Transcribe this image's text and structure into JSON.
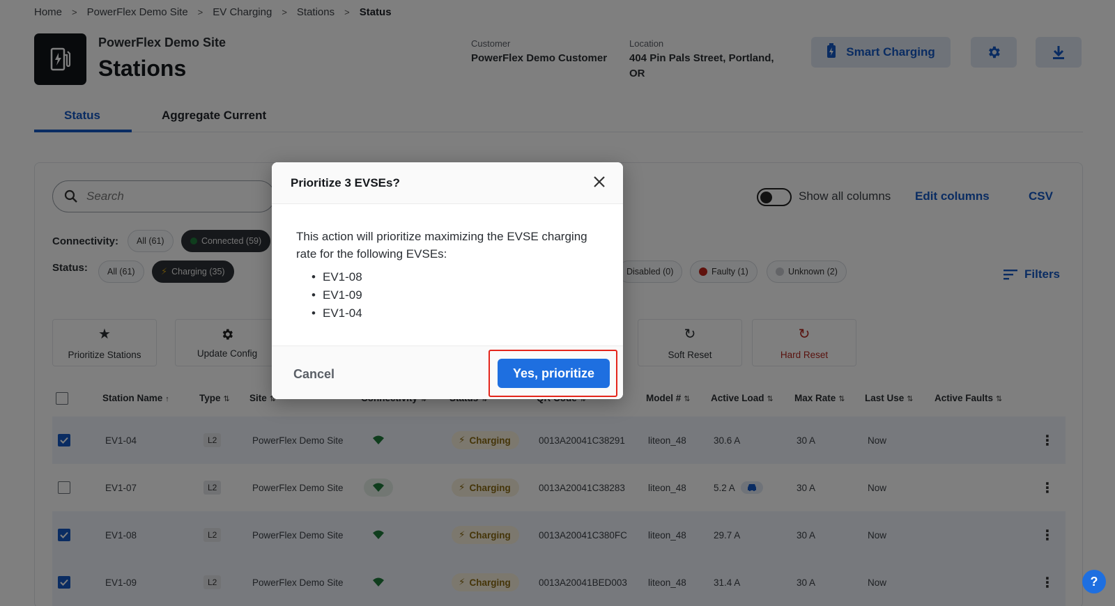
{
  "breadcrumb": [
    "Home",
    "PowerFlex Demo Site",
    "EV Charging",
    "Stations",
    "Status"
  ],
  "header": {
    "site_name": "PowerFlex Demo Site",
    "title": "Stations",
    "customer_label": "Customer",
    "customer_value": "PowerFlex Demo Customer",
    "location_label": "Location",
    "location_line1": "404 Pin Pals Street, Portland,",
    "location_line2": "OR",
    "smart_charging_label": "Smart Charging"
  },
  "tabs": [
    "Status",
    "Aggregate Current"
  ],
  "toolbar": {
    "search_placeholder": "Search",
    "show_all_columns": "Show all columns",
    "edit_columns": "Edit columns",
    "csv": "CSV",
    "filters": "Filters"
  },
  "filters": {
    "connectivity_label": "Connectivity:",
    "connectivity_all": "All (61)",
    "connectivity_connected": "Connected (59)",
    "status_label": "Status:",
    "status_all": "All (61)",
    "status_charging": "Charging (35)",
    "status_disabled": "Disabled (0)",
    "status_faulty": "Faulty (1)",
    "status_unknown": "Unknown (2)"
  },
  "actions": {
    "prioritize": "Prioritize Stations",
    "update_config": "Update Config",
    "soft_reset": "Soft Reset",
    "hard_reset": "Hard Reset"
  },
  "table": {
    "columns": {
      "station_name": "Station Name",
      "type": "Type",
      "site": "Site",
      "connectivity": "Connectivity",
      "status": "Status",
      "qr_code": "QR Code",
      "model": "Model #",
      "active_load": "Active Load",
      "max_rate": "Max Rate",
      "last_use": "Last Use",
      "active_faults": "Active Faults"
    },
    "rows": [
      {
        "name": "EV1-04",
        "type": "L2",
        "site": "PowerFlex Demo Site",
        "status": "Charging",
        "qr": "0013A20041C38291",
        "model": "liteon_48",
        "load": "30.6 A",
        "max": "30 A",
        "last": "Now",
        "selected": true
      },
      {
        "name": "EV1-07",
        "type": "L2",
        "site": "PowerFlex Demo Site",
        "status": "Charging",
        "qr": "0013A20041C38283",
        "model": "liteon_48",
        "load": "5.2 A",
        "max": "30 A",
        "last": "Now",
        "selected": false
      },
      {
        "name": "EV1-08",
        "type": "L2",
        "site": "PowerFlex Demo Site",
        "status": "Charging",
        "qr": "0013A20041C380FC",
        "model": "liteon_48",
        "load": "29.7 A",
        "max": "30 A",
        "last": "Now",
        "selected": true
      },
      {
        "name": "EV1-09",
        "type": "L2",
        "site": "PowerFlex Demo Site",
        "status": "Charging",
        "qr": "0013A20041BED003",
        "model": "liteon_48",
        "load": "31.4 A",
        "max": "30 A",
        "last": "Now",
        "selected": true
      }
    ]
  },
  "modal": {
    "title": "Prioritize 3 EVSEs?",
    "body": "This action will prioritize maximizing the EVSE charging rate for the following EVSEs:",
    "items": [
      "EV1-08",
      "EV1-09",
      "EV1-04"
    ],
    "cancel": "Cancel",
    "confirm": "Yes, prioritize"
  },
  "help_label": "?",
  "colors": {
    "brand_blue": "#1459c4",
    "primary_button": "#1e6fe0",
    "highlight_red": "#e4251b",
    "connected_green": "#1f7a3a",
    "charging_amber": "#8a6a12",
    "hard_reset_red": "#b3261e"
  }
}
